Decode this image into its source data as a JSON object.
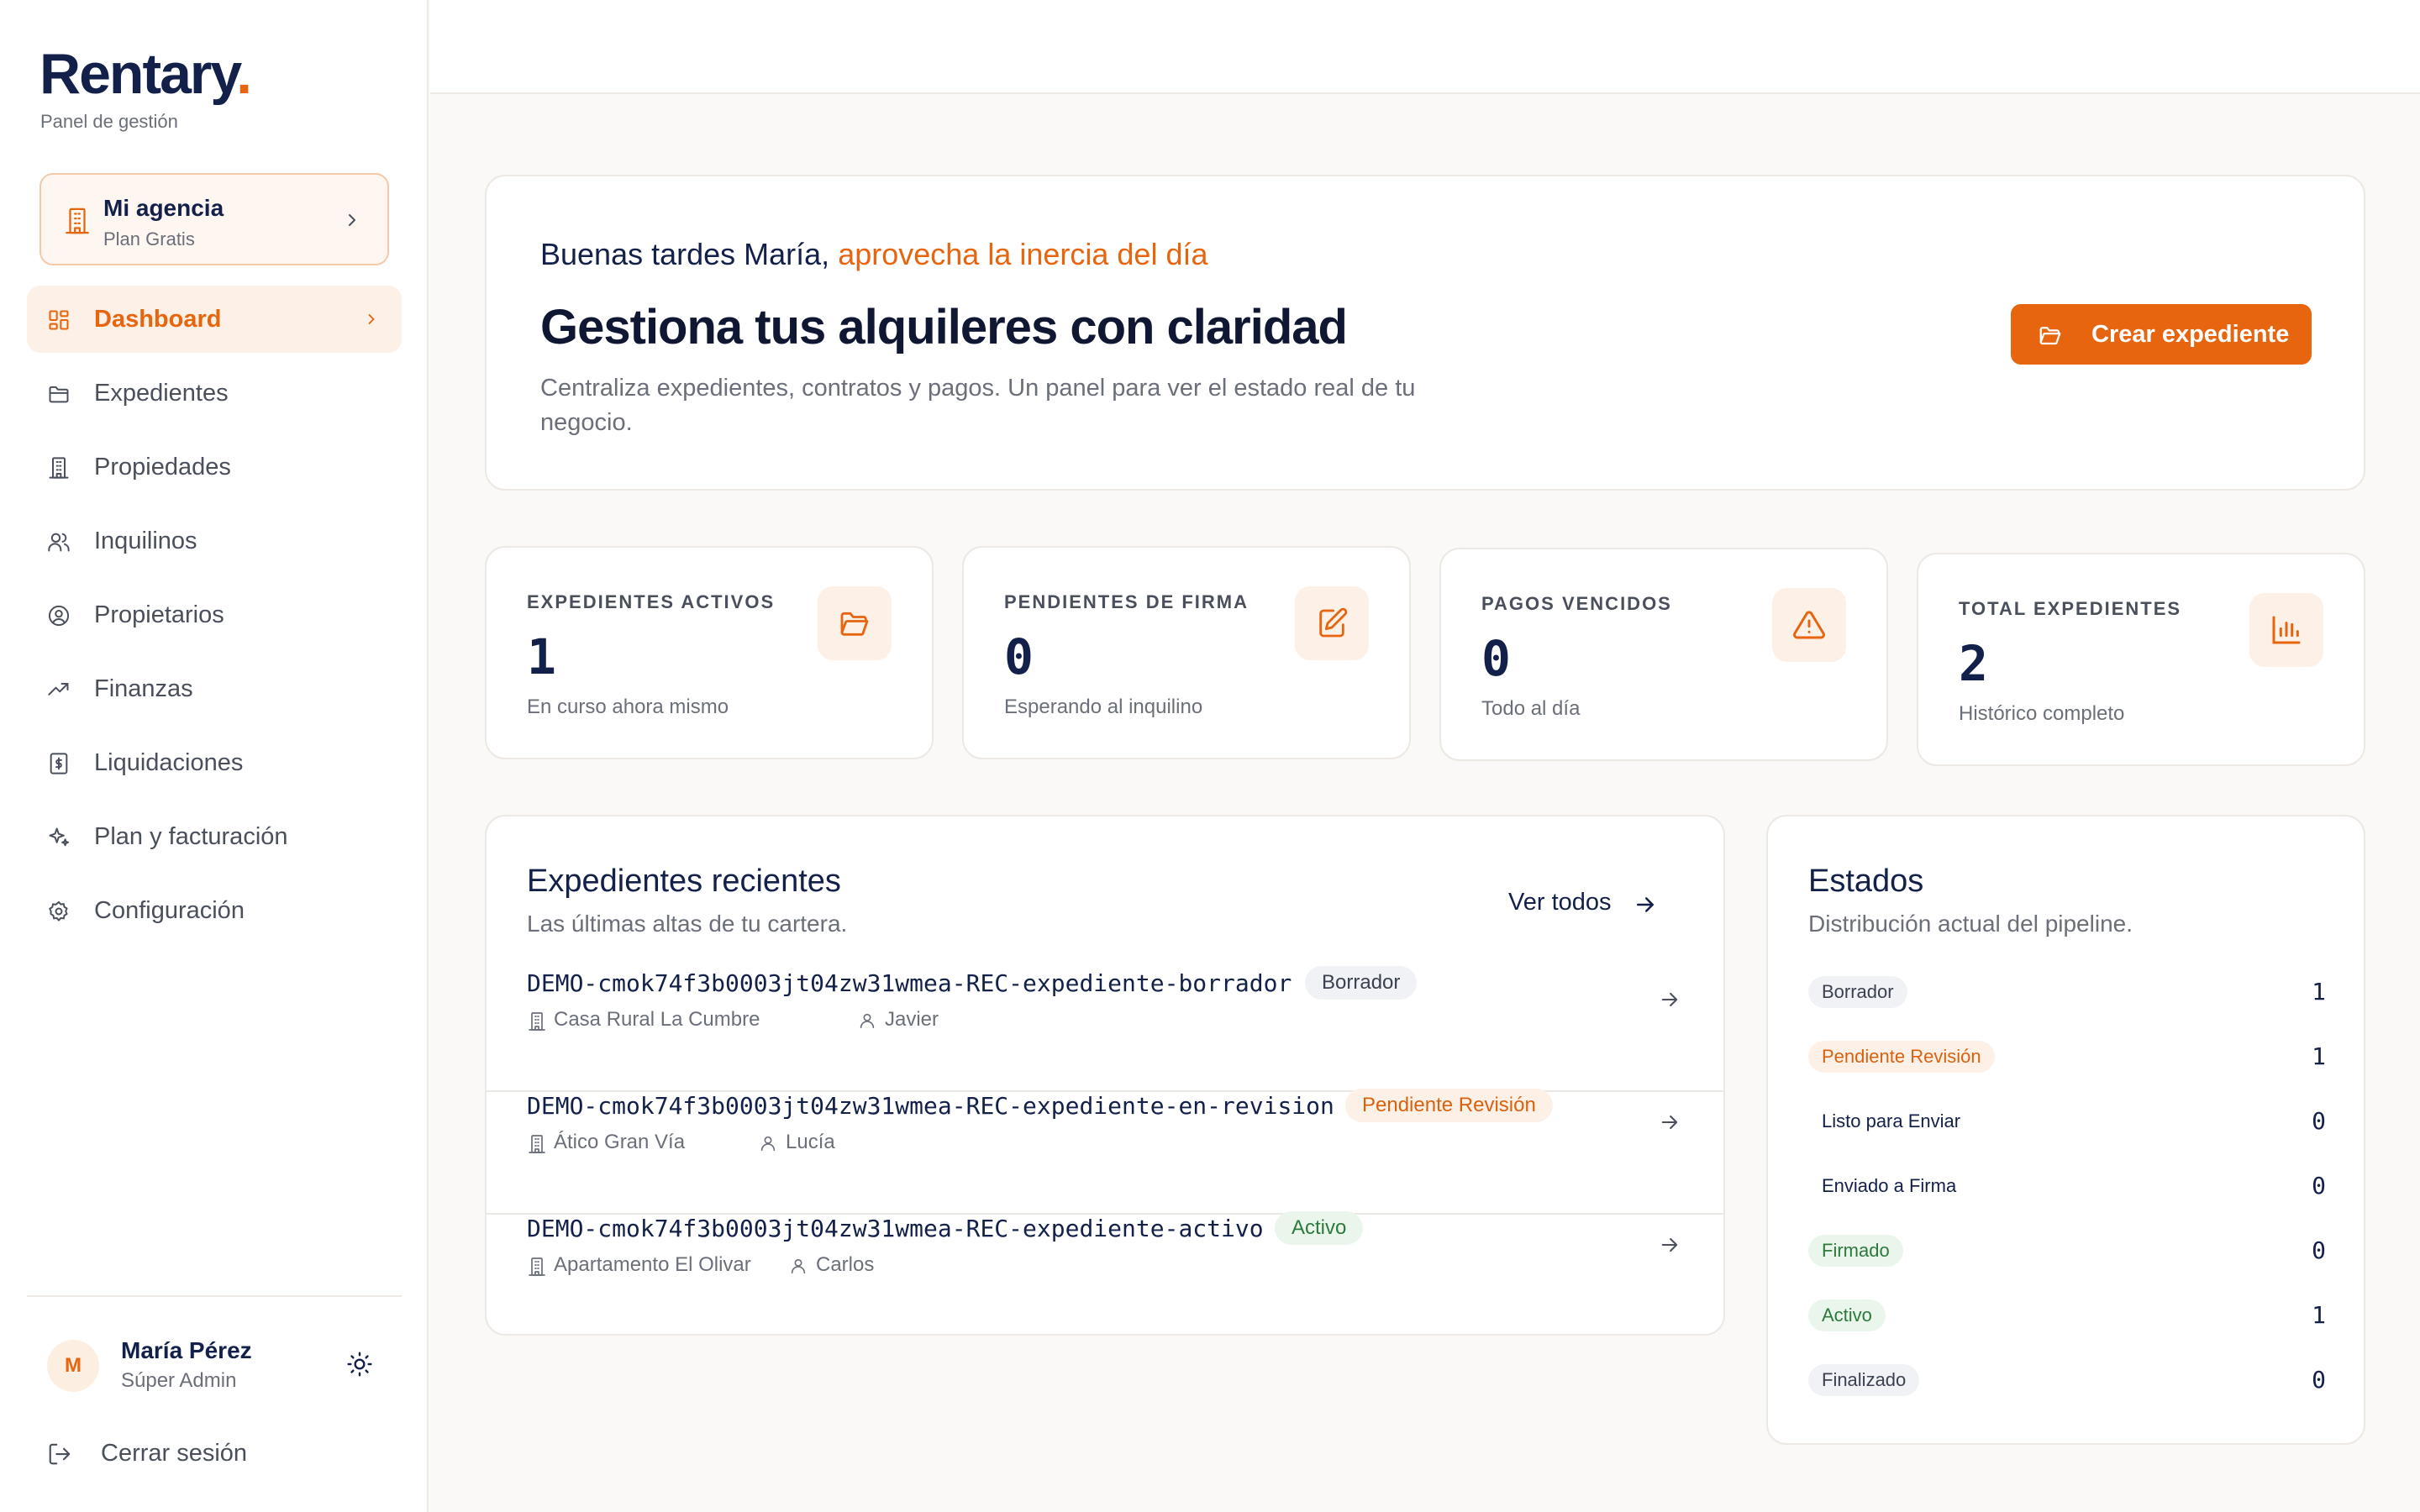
{
  "sidebar": {
    "logo": "Rentary",
    "logo_dot": ".",
    "subtitle": "Panel de gestión",
    "agency": {
      "name": "Mi agencia",
      "plan": "Plan Gratis"
    },
    "nav": [
      {
        "label": "Dashboard",
        "icon": "dashboard-icon",
        "active": true
      },
      {
        "label": "Expedientes",
        "icon": "folder-icon"
      },
      {
        "label": "Propiedades",
        "icon": "building-icon"
      },
      {
        "label": "Inquilinos",
        "icon": "users-icon"
      },
      {
        "label": "Propietarios",
        "icon": "user-circle-icon"
      },
      {
        "label": "Finanzas",
        "icon": "trending-up-icon"
      },
      {
        "label": "Liquidaciones",
        "icon": "receipt-icon"
      },
      {
        "label": "Plan y facturación",
        "icon": "sparkles-icon"
      },
      {
        "label": "Configuración",
        "icon": "gear-icon"
      }
    ],
    "user": {
      "initial": "M",
      "name": "María Pérez",
      "role": "Súper Admin"
    },
    "logout_label": "Cerrar sesión"
  },
  "hero": {
    "greeting": "Buenas tardes María,",
    "greeting_accent": "aprovecha la inercia del día",
    "title": "Gestiona tus alquileres con claridad",
    "description": "Centraliza expedientes, contratos y pagos. Un panel para ver el estado real de tu negocio.",
    "cta_label": "Crear expediente"
  },
  "stats": [
    {
      "label": "EXPEDIENTES ACTIVOS",
      "value": "1",
      "sub": "En curso ahora mismo",
      "icon": "folder-open-icon"
    },
    {
      "label": "PENDIENTES DE FIRMA",
      "value": "0",
      "sub": "Esperando al inquilino",
      "icon": "pen-square-icon"
    },
    {
      "label": "PAGOS VENCIDOS",
      "value": "0",
      "sub": "Todo al día",
      "icon": "warning-icon"
    },
    {
      "label": "TOTAL EXPEDIENTES",
      "value": "2",
      "sub": "Histórico completo",
      "icon": "bar-chart-icon"
    }
  ],
  "recent": {
    "title": "Expedientes recientes",
    "subtitle": "Las últimas altas de tu cartera.",
    "view_all": "Ver todos",
    "rows": [
      {
        "code": "DEMO-cmok74f3b0003jt04zw31wmea-REC-expediente-borrador",
        "status": "Borrador",
        "property": "Casa Rural La Cumbre",
        "tenant": "Javier"
      },
      {
        "code": "DEMO-cmok74f3b0003jt04zw31wmea-REC-expediente-en-revision",
        "status": "Pendiente Revisión",
        "property": "Ático Gran Vía",
        "tenant": "Lucía"
      },
      {
        "code": "DEMO-cmok74f3b0003jt04zw31wmea-REC-expediente-activo",
        "status": "Activo",
        "property": "Apartamento El Olivar",
        "tenant": "Carlos"
      }
    ]
  },
  "estados": {
    "title": "Estados",
    "subtitle": "Distribución actual del pipeline.",
    "items": [
      {
        "label": "Borrador",
        "count": "1"
      },
      {
        "label": "Pendiente Revisión",
        "count": "1"
      },
      {
        "label": "Listo para Enviar",
        "count": "0"
      },
      {
        "label": "Enviado a Firma",
        "count": "0"
      },
      {
        "label": "Firmado",
        "count": "0"
      },
      {
        "label": "Activo",
        "count": "1"
      },
      {
        "label": "Finalizado",
        "count": "0"
      }
    ]
  },
  "colors": {
    "accent": "#e8650f",
    "navy": "#13204a",
    "muted": "#6b6f7a",
    "background": "#faf9f7"
  }
}
